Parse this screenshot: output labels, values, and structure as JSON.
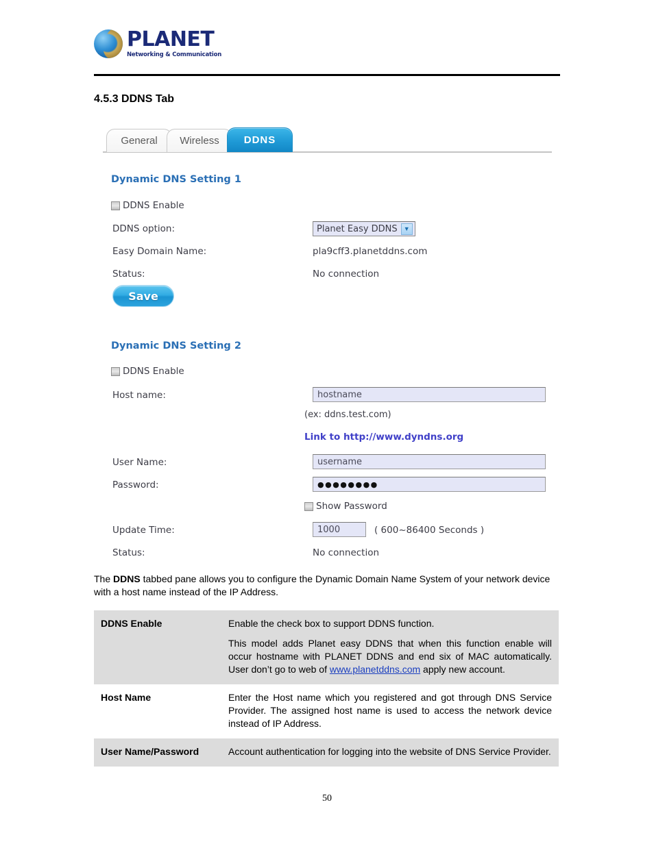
{
  "document": {
    "brand": {
      "name": "PLANET",
      "tagline": "Networking & Communication"
    },
    "section_heading": "4.5.3 DDNS Tab",
    "page_number": "50"
  },
  "ui": {
    "tabs": [
      {
        "label": "General",
        "active": false
      },
      {
        "label": "Wireless",
        "active": false
      },
      {
        "label": "DDNS",
        "active": true
      }
    ],
    "setting1": {
      "title": "Dynamic DNS Setting 1",
      "enable_label": "DDNS Enable",
      "enable_checked": false,
      "option_label": "DDNS option:",
      "option_value": "Planet Easy DDNS",
      "domain_label": "Easy Domain Name:",
      "domain_value": "pla9cff3.planetddns.com",
      "status_label": "Status:",
      "status_value": "No connection",
      "save_label": "Save"
    },
    "setting2": {
      "title": "Dynamic DNS Setting 2",
      "enable_label": "DDNS Enable",
      "enable_checked": false,
      "hostname_label": "Host name:",
      "hostname_value": "hostname",
      "hostname_hint": "(ex: ddns.test.com)",
      "link_text": "Link to http://www.dyndns.org",
      "username_label": "User Name:",
      "username_value": "username",
      "password_label": "Password:",
      "password_value": "●●●●●●●●",
      "show_password_label": "Show Password",
      "show_password_checked": false,
      "update_time_label": "Update Time:",
      "update_time_value": "1000",
      "update_time_suffix": "( 600~86400 Seconds )",
      "status_label": "Status:",
      "status_value": "No connection"
    }
  },
  "description": {
    "intro_before": "The ",
    "intro_bold": "DDNS",
    "intro_after": " tabbed pane allows you to configure the Dynamic Domain Name System of your network device with a host name instead of the IP Address."
  },
  "table": {
    "rows": [
      {
        "term": "DDNS Enable",
        "para1": "Enable the check box to support DDNS function.",
        "para2_before": "This model adds Planet easy DDNS that when this function enable will occur hostname with PLANET DDNS and end six of MAC automatically. User don’t go to web of ",
        "para2_link": "www.planetddns.com",
        "para2_after": " apply new account.",
        "shaded": true
      },
      {
        "term": "Host Name",
        "para1": "Enter the Host name which you registered and got through DNS Service Provider. The assigned host name is used to access the network device instead of IP Address.",
        "shaded": false
      },
      {
        "term": "User Name/Password",
        "para1": "Account authentication for logging into the website of DNS Service Provider.",
        "shaded": true
      }
    ]
  },
  "colors": {
    "accent_blue": "#2a6fb5",
    "tab_active": "#1f9ad6",
    "link": "#4040c8",
    "table_shade": "#dcdcdc",
    "brand_navy": "#1b2a77"
  }
}
